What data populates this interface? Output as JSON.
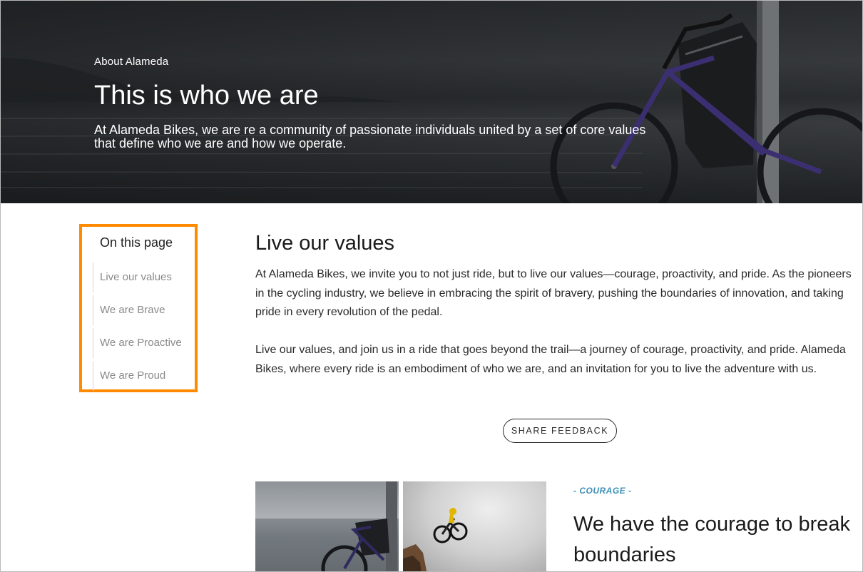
{
  "hero": {
    "eyebrow": "About Alameda",
    "title": "This is who we are",
    "subtitle": "At Alameda Bikes, we are re a community of passionate individuals united by a set of core values that define who we are and how we operate."
  },
  "toc": {
    "title": "On this page",
    "items": [
      {
        "label": "Live our values"
      },
      {
        "label": "We are Brave"
      },
      {
        "label": "We are Proactive"
      },
      {
        "label": "We are Proud"
      }
    ],
    "highlight_color": "#ff8a00"
  },
  "main": {
    "section_title": "Live our values",
    "paragraph_1": "At Alameda Bikes, we invite you to not just ride, but to live our values—courage, proactivity, and pride. As the pioneers in the cycling industry, we believe in embracing the spirit of bravery, pushing the boundaries of innovation, and taking pride in every revolution of the pedal.",
    "paragraph_2": "Live our values, and join us in a ride that goes beyond the trail—a journey of courage, proactivity, and pride. Alameda Bikes, where every ride is an embodiment of who we are, and an invitation for you to live the adventure with us.",
    "feedback_button": "SHARE FEEDBACK"
  },
  "courage": {
    "kicker": "- COURAGE -",
    "title": "We have the courage to break boundaries",
    "accent_color": "#3d8fb8"
  },
  "icons": {
    "hero_image": "bicycle-by-lake-photo",
    "photo_1": "bicycle-on-pier-photo",
    "photo_2": "bmx-jump-photo"
  }
}
